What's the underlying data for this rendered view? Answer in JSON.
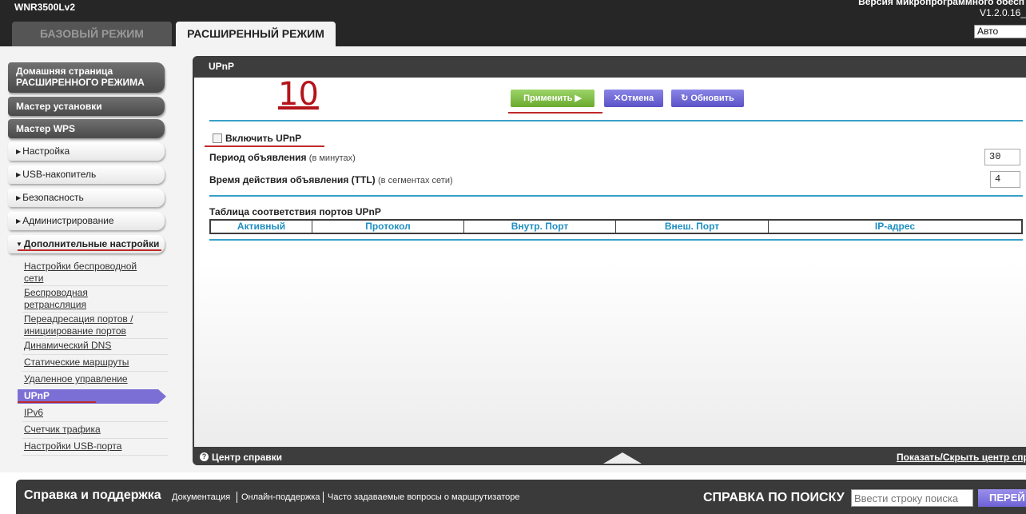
{
  "header": {
    "model": "WNR3500Lv2",
    "firmware_label": "Версия микропрограммного обесп",
    "firmware_version": "V1.2.0.16_",
    "tab_basic": "БАЗОВЫЙ РЕЖИМ",
    "tab_advanced": "РАСШИРЕННЫЙ РЕЖИМ",
    "language": "Авто"
  },
  "sidebar": {
    "home_line1": "Домашняя страница",
    "home_line2": "РАСШИРЕННОГО РЕЖИМА",
    "setup_wizard": "Мастер установки",
    "wps_wizard": "Мастер WPS",
    "sections": [
      "Настройка",
      "USB-накопитель",
      "Безопасность",
      "Администрирование",
      "Дополнительные настройки"
    ],
    "arrow_collapsed": "▶",
    "arrow_expanded": "▼",
    "submenu": [
      {
        "l1": "Настройки беспроводной",
        "l2": "сети"
      },
      {
        "l1": "Беспроводная",
        "l2": "ретрансляция"
      },
      {
        "l1": "Переадресация портов /",
        "l2": "инициирование портов"
      },
      {
        "l1": "Динамический DNS",
        "l2": ""
      },
      {
        "l1": "Статические маршруты",
        "l2": ""
      },
      {
        "l1": "Удаленное управление",
        "l2": ""
      },
      {
        "l1": "UPnP",
        "l2": ""
      },
      {
        "l1": "IPv6",
        "l2": ""
      },
      {
        "l1": "Счетчик трафика",
        "l2": ""
      },
      {
        "l1": "Настройки USB-порта",
        "l2": ""
      }
    ]
  },
  "panel": {
    "title": "UPnP",
    "step_number": "10",
    "apply_label": "Применить ▶",
    "cancel_label": "✕Отмена",
    "refresh_label": "↻ Обновить",
    "enable_label": "Включить UPnP",
    "period_label": "Период объявления",
    "period_note": "(в минутах)",
    "period_value": "30",
    "ttl_label": "Время действия объявления (TTL)",
    "ttl_note": "(в сегментах сети)",
    "ttl_value": "4",
    "table_title": "Таблица соответствия портов UPnP",
    "table_headers": [
      "Активный",
      "Протокол",
      "Внутр. Порт",
      "Внеш. Порт",
      "IP-адрес"
    ],
    "help_center": "Центр справки",
    "show_hide": "Показать/Скрыть центр спра"
  },
  "footer": {
    "support_title": "Справка и поддержка",
    "links": [
      "Документация",
      "Онлайн-поддержка",
      "Часто задаваемые вопросы о маршрутизаторе"
    ],
    "search_title": "СПРАВКА ПО ПОИСКУ",
    "search_placeholder": "Ввести строку поиска",
    "search_button": "ПЕРЕЙ"
  },
  "colors": {
    "dark": "#262626",
    "accent_blue": "#3aa0c8",
    "active_purple": "#7b6fd6",
    "apply_green": "#7cbf3f",
    "annotation_red": "#c0282a"
  }
}
